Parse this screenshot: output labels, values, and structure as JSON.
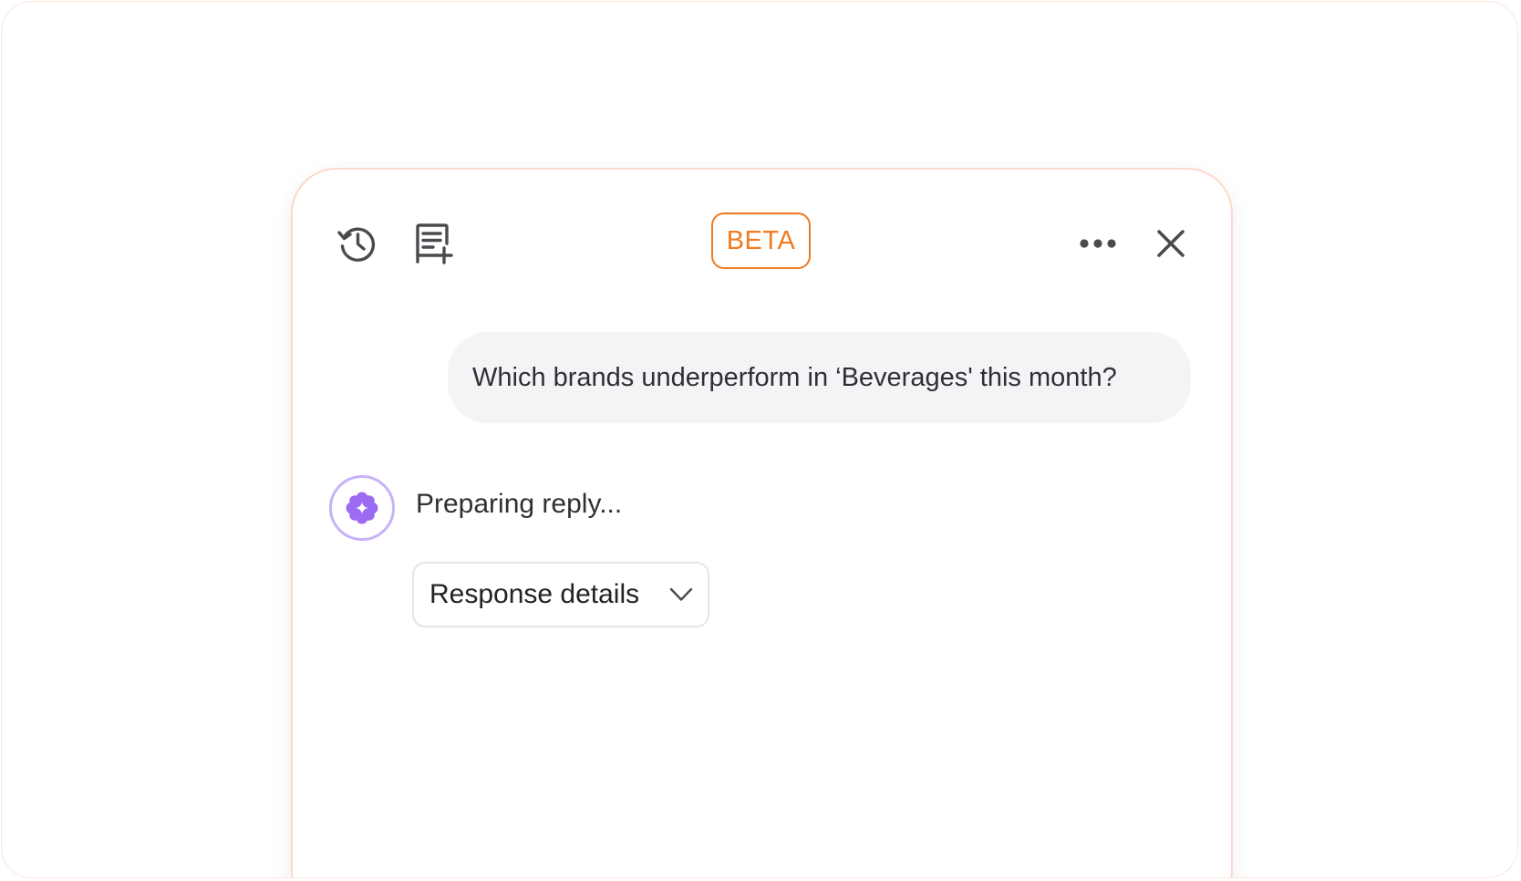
{
  "header": {
    "badge_label": "BETA",
    "icons": {
      "history": "history-icon",
      "new_chat": "new-chat-icon",
      "more": "more-options-icon",
      "close": "close-icon"
    }
  },
  "conversation": {
    "user_message": "Which brands underperform in ‘Beverages' this month?",
    "assistant": {
      "avatar_icon": "sparkle-flower-icon",
      "status": "Preparing reply..."
    },
    "details_toggle": {
      "label": "Response details",
      "icon": "chevron-down-icon"
    }
  },
  "colors": {
    "accent": "#f07a1f",
    "avatar_ring": "#c9b2f7",
    "avatar_glyph": "#8b5cf6",
    "bubble_bg": "#f3f4f6",
    "panel_border": "#fcd9cb"
  }
}
